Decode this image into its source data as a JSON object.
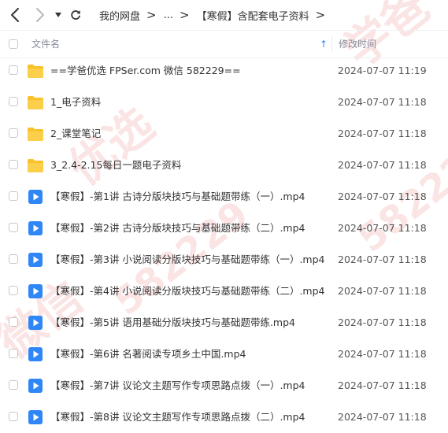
{
  "toolbar": {
    "back_icon": "back-arrow-icon",
    "forward_icon": "forward-arrow-icon",
    "dropdown_icon": "caret-down-icon",
    "refresh_icon": "refresh-icon",
    "breadcrumb": {
      "root": "我的网盘",
      "ellipsis": "...",
      "current": "【寒假】含配套电子资料",
      "separator": ">"
    }
  },
  "header": {
    "name_label": "文件名",
    "sort_arrow": "↑",
    "date_label": "修改时间"
  },
  "files": [
    {
      "type": "folder",
      "name": "==学爸优选 FPSer.com 微信 582229==",
      "modified": "2024-07-07 11:19"
    },
    {
      "type": "folder",
      "name": "1_电子资料",
      "modified": "2024-07-07 11:18"
    },
    {
      "type": "folder",
      "name": "2_课堂笔记",
      "modified": "2024-07-07 11:18"
    },
    {
      "type": "folder",
      "name": "3_2.4-2.15每日一题电子资料",
      "modified": "2024-07-07 11:18"
    },
    {
      "type": "video",
      "name": "【寒假】-第1讲 古诗分版块技巧与基础题带练（一）.mp4",
      "modified": "2024-07-07 11:18"
    },
    {
      "type": "video",
      "name": "【寒假】-第2讲 古诗分版块技巧与基础题带练（二）.mp4",
      "modified": "2024-07-07 11:18"
    },
    {
      "type": "video",
      "name": "【寒假】-第3讲 小说阅读分版块技巧与基础题带练（一）.mp4",
      "modified": "2024-07-07 11:18"
    },
    {
      "type": "video",
      "name": "【寒假】-第4讲 小说阅读分版块技巧与基础题带练（二）.mp4",
      "modified": "2024-07-07 11:18"
    },
    {
      "type": "video",
      "name": "【寒假】-第5讲 语用基础分版块技巧与基础题带练.mp4",
      "modified": "2024-07-07 11:18"
    },
    {
      "type": "video",
      "name": "【寒假】-第6讲 名著阅读专项乡土中国.mp4",
      "modified": "2024-07-07 11:18"
    },
    {
      "type": "video",
      "name": "【寒假】-第7讲 议论文主题写作专项思路点拨（一）.mp4",
      "modified": "2024-07-07 11:18"
    },
    {
      "type": "video",
      "name": "【寒假】-第8讲 议论文主题写作专项思路点拨（二）.mp4",
      "modified": "2024-07-07 11:18"
    }
  ],
  "watermark": {
    "texts": [
      "学爸",
      "优选",
      "微信",
      "582229",
      "582229"
    ]
  },
  "colors": {
    "folder": "#f9c22b",
    "video_icon": "#2f86f6",
    "accent": "#2f86f6",
    "watermark": "#e25858"
  }
}
